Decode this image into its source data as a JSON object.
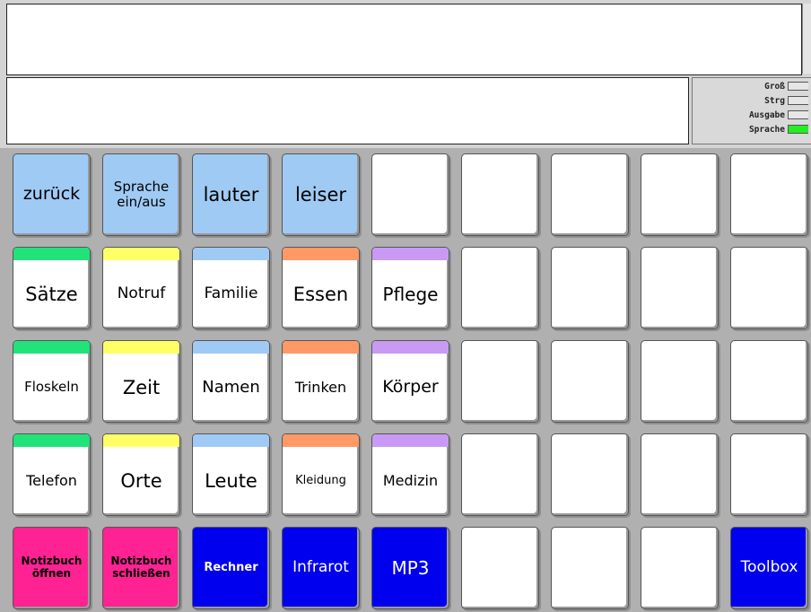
{
  "status": {
    "items": [
      {
        "label": "Groß",
        "active": false
      },
      {
        "label": "Strg",
        "active": false
      },
      {
        "label": "Ausgabe",
        "active": false
      },
      {
        "label": "Sprache",
        "active": true
      }
    ],
    "active_color": "#22ee22"
  },
  "colors": {
    "control_blue": "#9fcaf4",
    "green": "#22e27a",
    "yellow": "#ffff66",
    "lightblue": "#9fcaf4",
    "orange": "#ff9966",
    "purple": "#c89af4",
    "pink": "#ff2292",
    "navy": "#0000ee"
  },
  "grid": {
    "row1": {
      "zurueck": "zurück",
      "sprache_line1": "Sprache",
      "sprache_line2": "ein/aus",
      "lauter": "lauter",
      "leiser": "leiser"
    },
    "row2": {
      "saetze": "Sätze",
      "notruf": "Notruf",
      "familie": "Familie",
      "essen": "Essen",
      "pflege": "Pflege"
    },
    "row3": {
      "floskeln": "Floskeln",
      "zeit": "Zeit",
      "namen": "Namen",
      "trinken": "Trinken",
      "koerper": "Körper"
    },
    "row4": {
      "telefon": "Telefon",
      "orte": "Orte",
      "leute": "Leute",
      "kleidung": "Kleidung",
      "medizin": "Medizin"
    },
    "row5": {
      "notizbuch_oeffnen_l1": "Notizbuch",
      "notizbuch_oeffnen_l2": "öffnen",
      "notizbuch_schliessen_l1": "Notizbuch",
      "notizbuch_schliessen_l2": "schließen",
      "rechner": "Rechner",
      "infrarot": "Infrarot",
      "mp3": "MP3",
      "toolbox": "Toolbox"
    }
  }
}
